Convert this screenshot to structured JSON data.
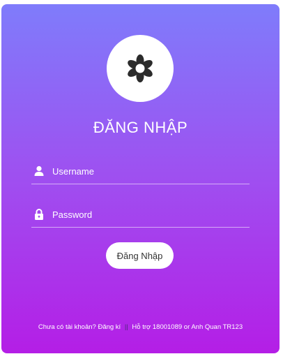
{
  "login": {
    "title": "ĐĂNG NHẬP",
    "logo_icon": "flower-icon",
    "username": {
      "icon": "user-icon",
      "placeholder": "Username",
      "value": ""
    },
    "password": {
      "icon": "lock-icon",
      "placeholder": "Password",
      "value": ""
    },
    "submit_label": "Đăng Nhập"
  },
  "footer": {
    "prompt": "Chưa có tài khoản?",
    "register_link": "Đăng kí",
    "separator": "||",
    "support": "Hỗ trợ 18001089 or Anh Quan TR123"
  },
  "colors": {
    "gradient_top": "#7f7cfb",
    "gradient_bottom": "#b41ee6",
    "accent": "#ffffff"
  }
}
